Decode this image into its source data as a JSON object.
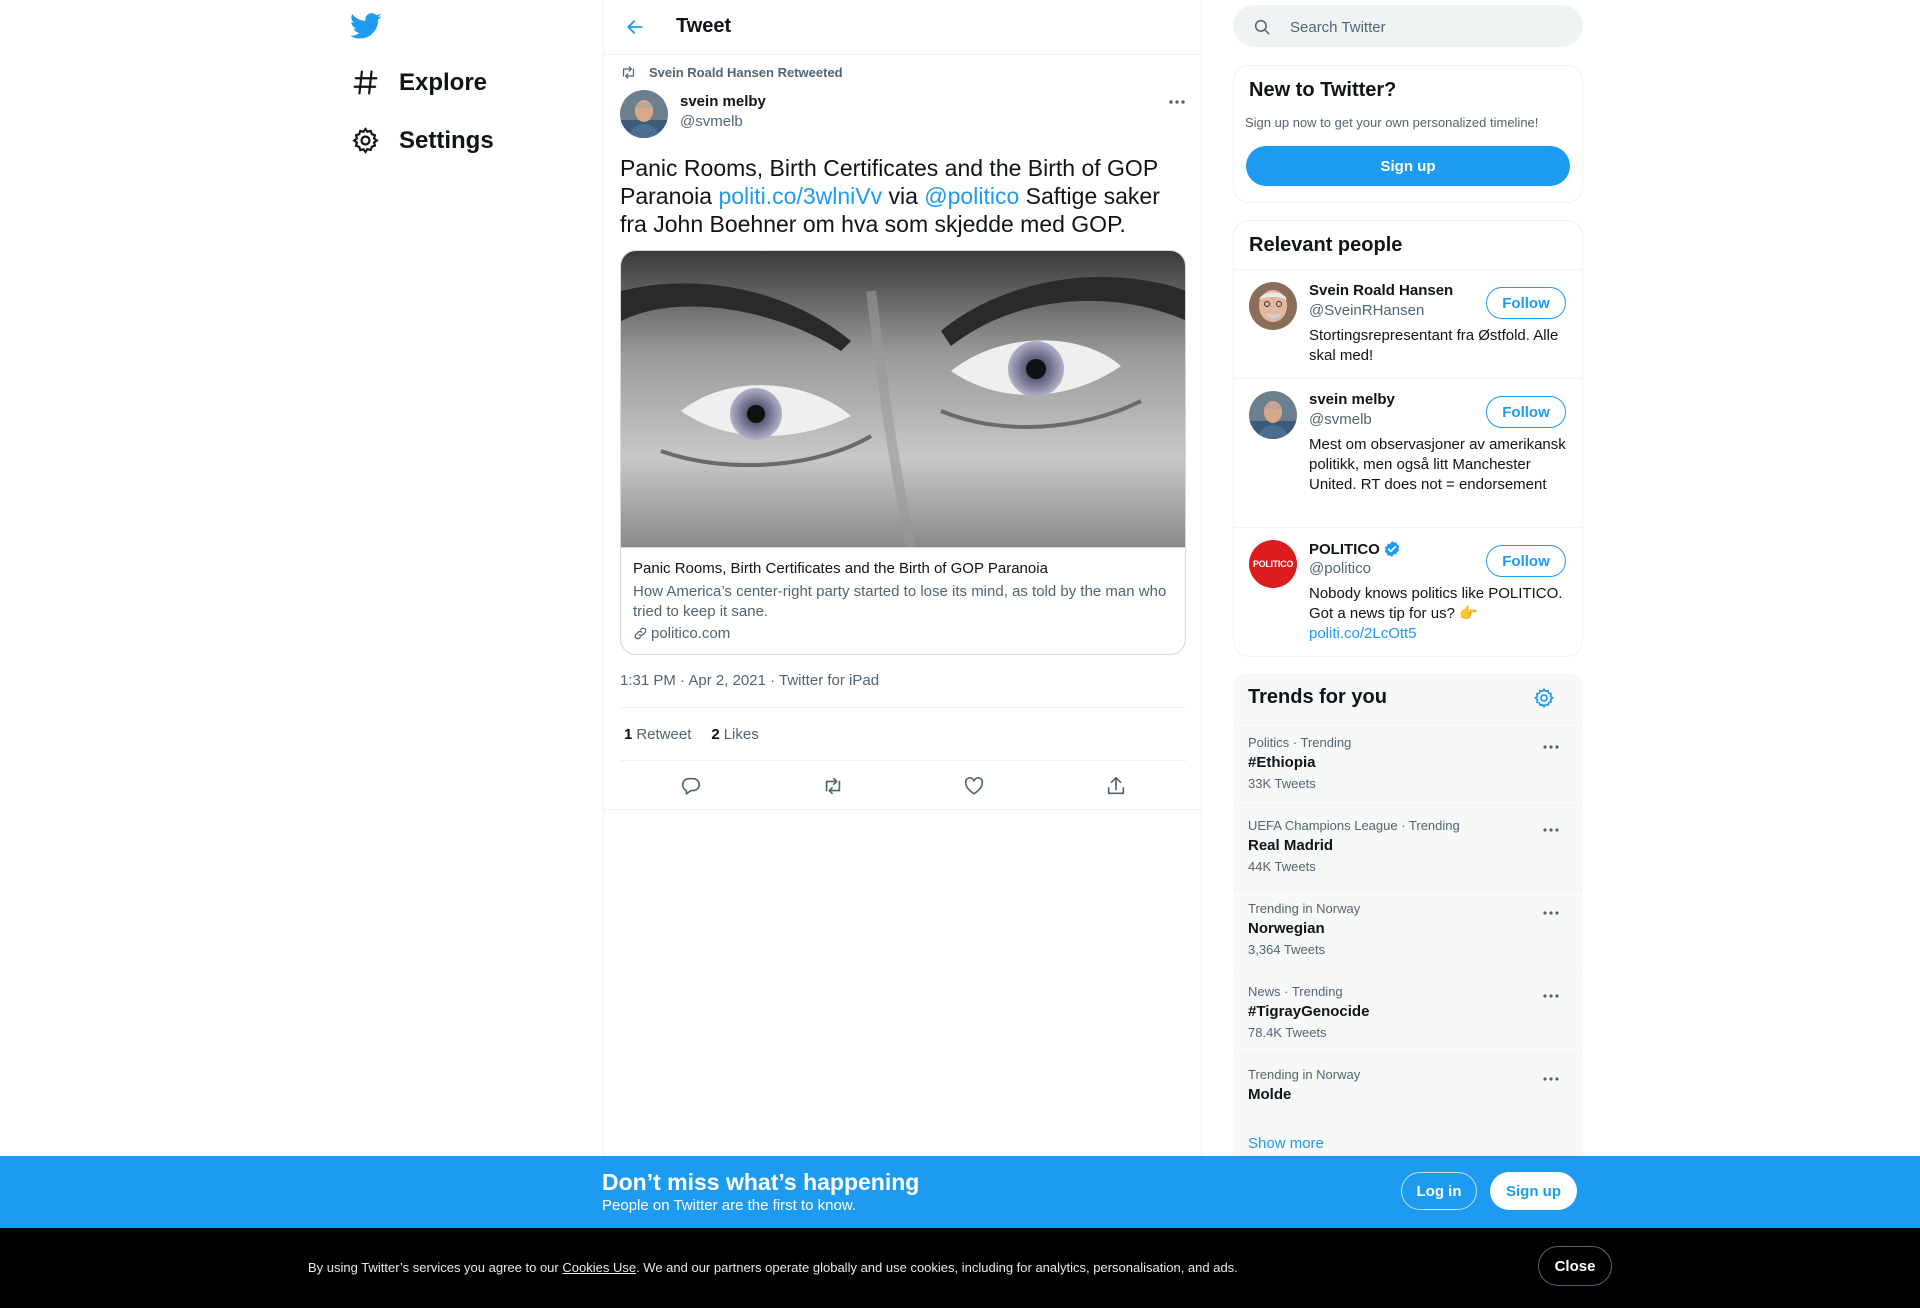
{
  "colors": {
    "accent": "#1d9bf0",
    "text": "#0f1419",
    "muted": "#536471",
    "border": "#eff3f4",
    "politico_red": "#dd1c1f"
  },
  "left_nav": {
    "logo_icon": "twitter-bird-icon",
    "items": [
      {
        "label": "Explore",
        "icon": "hashtag-icon"
      },
      {
        "label": "Settings",
        "icon": "gear-icon"
      }
    ]
  },
  "header": {
    "title": "Tweet",
    "back_icon": "arrow-left-icon"
  },
  "tweet": {
    "retweet_context": "Svein Roald Hansen Retweeted",
    "author": {
      "name": "svein melby",
      "handle": "@svmelb"
    },
    "text_parts": {
      "t1": "Panic Rooms, Birth Certificates and the Birth of GOP Paranoia ",
      "link1": "politi.co/3wlniVv",
      "t2": " via ",
      "mention": "@politico",
      "t3": " Saftige saker fra John Boehner om hva som skjedde med GOP."
    },
    "card": {
      "title": "Panic Rooms, Birth Certificates and the Birth of GOP Paranoia",
      "description": "How America’s center-right party started to lose its mind, as told by the man who tried to keep it sane.",
      "domain": "politico.com"
    },
    "time": "1:31 PM",
    "date": "Apr 2, 2021",
    "source": "Twitter for iPad",
    "stats": {
      "retweets_count": "1",
      "retweets_label": "Retweet",
      "likes_count": "2",
      "likes_label": "Likes"
    }
  },
  "search": {
    "placeholder": "Search Twitter"
  },
  "new_to_twitter": {
    "title": "New to Twitter?",
    "subtitle": "Sign up now to get your own personalized timeline!",
    "button": "Sign up"
  },
  "relevant_people": {
    "title": "Relevant people",
    "follow_label": "Follow",
    "people": [
      {
        "name": "Svein Roald Hansen",
        "handle": "@SveinRHansen",
        "bio": "Stortingsrepresentant fra Østfold. Alle skal med!"
      },
      {
        "name": "svein melby",
        "handle": "@svmelb",
        "bio": "Mest om observasjoner av amerikansk politikk, men også litt Manchester United. RT does not = endorsement"
      },
      {
        "name": "POLITICO",
        "handle": "@politico",
        "bio": "Nobody knows politics like POLITICO. Got a news tip for us? 👉",
        "bio_link": "politi.co/2LcOtt5",
        "verified": true,
        "logo_text": "POLITICO"
      }
    ]
  },
  "trends": {
    "title": "Trends for you",
    "items": [
      {
        "context": "Politics · Trending",
        "name": "#Ethiopia",
        "count": "33K Tweets"
      },
      {
        "context": "UEFA Champions League · Trending",
        "name": "Real Madrid",
        "count": "44K Tweets"
      },
      {
        "context": "Trending in Norway",
        "name": "Norwegian",
        "count": "3,364 Tweets"
      },
      {
        "context": "News · Trending",
        "name": "#TigrayGenocide",
        "count": "78.4K Tweets"
      },
      {
        "context": "Trending in Norway",
        "name": "Molde",
        "count": ""
      }
    ],
    "show_more": "Show more"
  },
  "bottom_bar": {
    "title": "Don’t miss what’s happening",
    "subtitle": "People on Twitter are the first to know.",
    "login": "Log in",
    "signup": "Sign up"
  },
  "cookie_bar": {
    "text_before": "By using Twitter’s services you agree to our ",
    "link": "Cookies Use",
    "text_after": ". We and our partners operate globally and use cookies, including for analytics, personalisation, and ads.",
    "close": "Close"
  }
}
